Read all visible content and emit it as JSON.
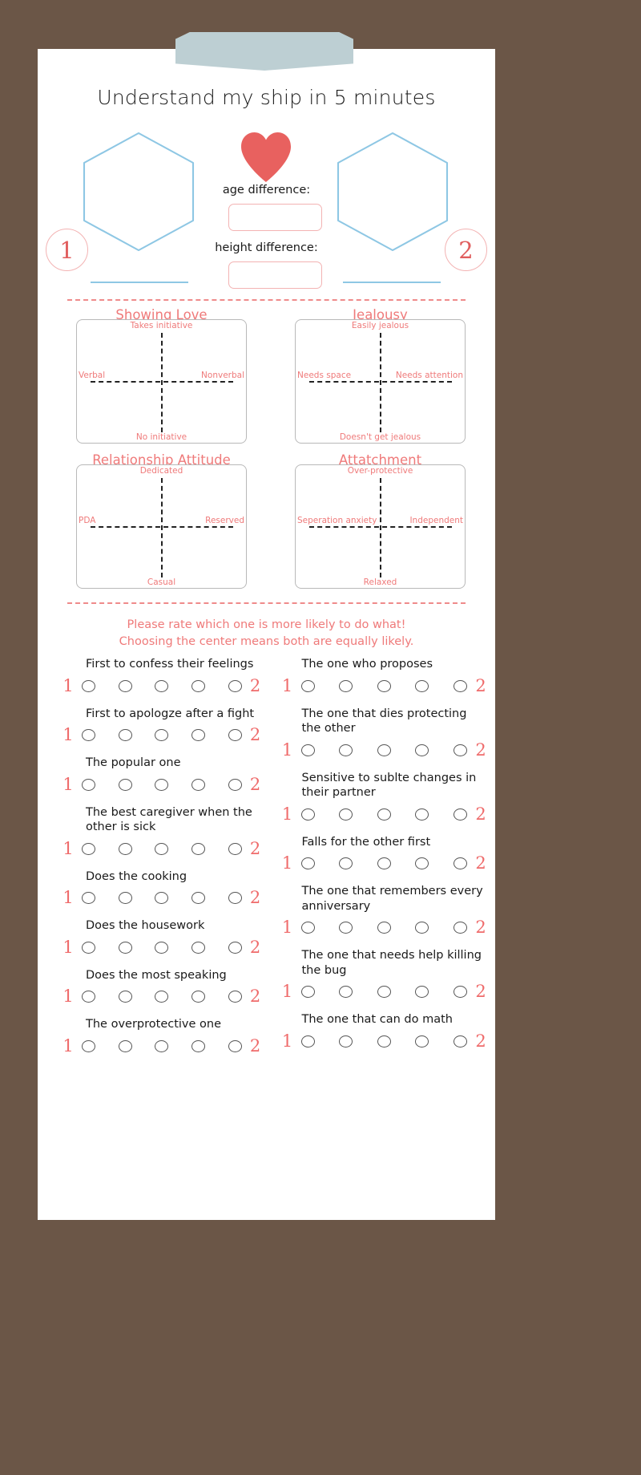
{
  "page": {
    "title": "Understand my ship in 5 minutes",
    "board_color": "#6b5647",
    "paper_color": "#ffffff",
    "clip_color": "#bdcfd3",
    "accent_red": "#ef7a7a",
    "accent_blue": "#8ec7e4"
  },
  "profiles": {
    "left_number": "1",
    "right_number": "2",
    "heart_icon": "heart-icon"
  },
  "fields": [
    {
      "label": "age difference:",
      "value": "",
      "placeholder": ""
    },
    {
      "label": "height difference:",
      "value": "",
      "placeholder": ""
    }
  ],
  "quadrants": [
    {
      "title": "Showing Love",
      "top": "Takes initiative",
      "bottom": "No initiative",
      "left": "Verbal",
      "right": "Nonverbal"
    },
    {
      "title": "Jealousy",
      "top": "Easily jealous",
      "bottom": "Doesn't get jealous",
      "left": "Needs space",
      "right": "Needs attention"
    },
    {
      "title": "Relationship Attitude",
      "top": "Dedicated",
      "bottom": "Casual",
      "left": "PDA",
      "right": "Reserved"
    },
    {
      "title": "Attatchment",
      "top": "Over-protective",
      "bottom": "Relaxed",
      "left": "Seperation anxiety",
      "right": "Independent"
    }
  ],
  "instructions": {
    "line1": "Please rate which one is more likely to do what!",
    "line2": "Choosing the center means both are equally likely."
  },
  "scale": {
    "left_end": "1",
    "right_end": "2",
    "bubble_count": 5
  },
  "questions": {
    "left_column": [
      "First to confess their feelings",
      "First to apologze after a fight",
      "The popular one",
      "The best caregiver when the other is sick",
      "Does the cooking",
      "Does the housework",
      "Does the most speaking",
      "The overprotective one"
    ],
    "right_column": [
      "The one who proposes",
      "The one that dies protecting the other",
      "Sensitive to sublte changes in their partner",
      "Falls for the other first",
      "The one that remembers every anniversary",
      "The one that needs help killing the bug",
      "The one that can do math"
    ]
  }
}
